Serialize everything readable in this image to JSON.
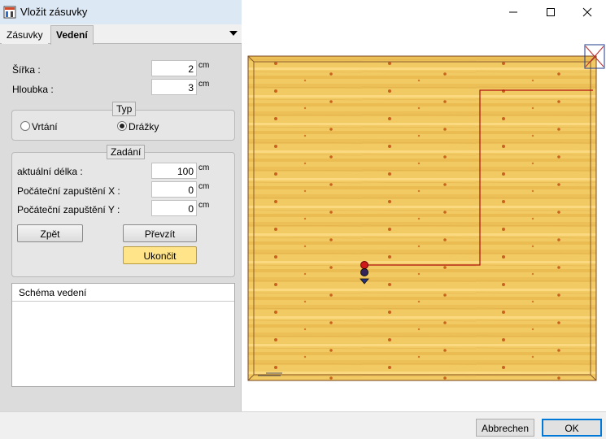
{
  "window": {
    "title": "Vložit zásuvky"
  },
  "tabs": [
    {
      "label": "Zásuvky"
    },
    {
      "label": "Vedení"
    }
  ],
  "dimensions": {
    "width": {
      "label": "Šířka :",
      "value": "2",
      "unit": "cm"
    },
    "depth": {
      "label": "Hloubka :",
      "value": "3",
      "unit": "cm"
    }
  },
  "type_group": {
    "title": "Typ",
    "options": [
      {
        "label": "Vrtání",
        "selected": false
      },
      {
        "label": "Drážky",
        "selected": true
      }
    ]
  },
  "input_group": {
    "title": "Zadání",
    "current_length": {
      "label": "aktuální délka :",
      "value": "100",
      "unit": "cm"
    },
    "offset_x": {
      "label": "Počáteční zapuštění X :",
      "value": "0",
      "unit": "cm"
    },
    "offset_y": {
      "label": "Počáteční zapuštění Y :",
      "value": "0",
      "unit": "cm"
    },
    "back_button": "Zpět",
    "take_over_button": "Převzít",
    "finish_button": "Ukončit"
  },
  "schema": {
    "header": "Schéma vedení"
  },
  "footer": {
    "cancel": "Abbrechen",
    "ok": "OK"
  },
  "colors": {
    "accent": "#0078d7",
    "routing_line": "#b01010",
    "highlight_button": "#ffe48a"
  }
}
